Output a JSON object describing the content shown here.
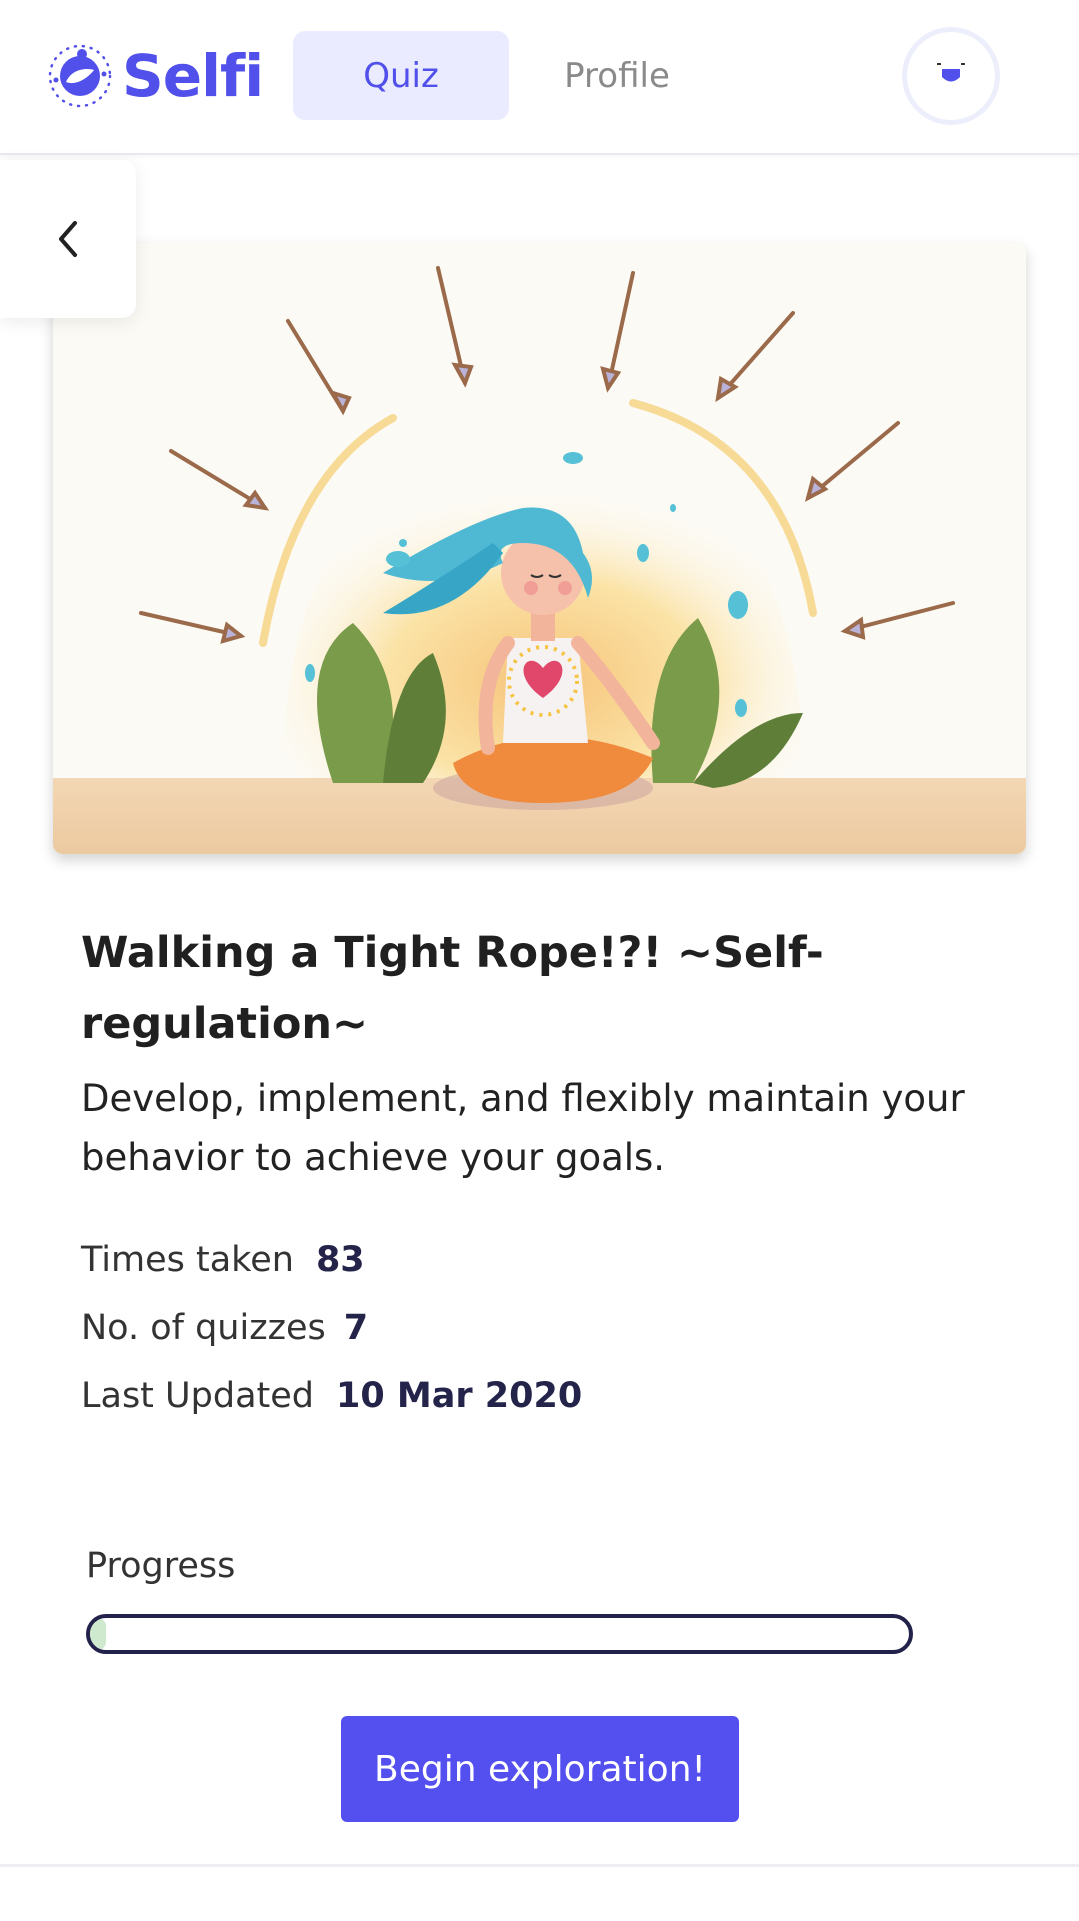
{
  "header": {
    "brand": "Selfi",
    "tabs": [
      {
        "label": "Quiz",
        "active": true
      },
      {
        "label": "Profile",
        "active": false
      }
    ],
    "accent_color": "#5150ea",
    "avatar_icon": "smiley-face-icon"
  },
  "navigation": {
    "back_icon": "chevron-left-icon"
  },
  "quiz": {
    "title": "Walking a Tight Rope!?! ~Self-regulation~",
    "description": "Develop, implement, and flexibly maintain your behavior to achieve your goals.",
    "stats": [
      {
        "label": "Times taken",
        "value": "83"
      },
      {
        "label": "No. of quizzes",
        "value": "7"
      },
      {
        "label": "Last Updated",
        "value": "10 Mar 2020"
      }
    ],
    "progress_label": "Progress",
    "progress_fraction": 0.02,
    "cta_label": "Begin exploration!",
    "cta_color": "#5450f0"
  }
}
